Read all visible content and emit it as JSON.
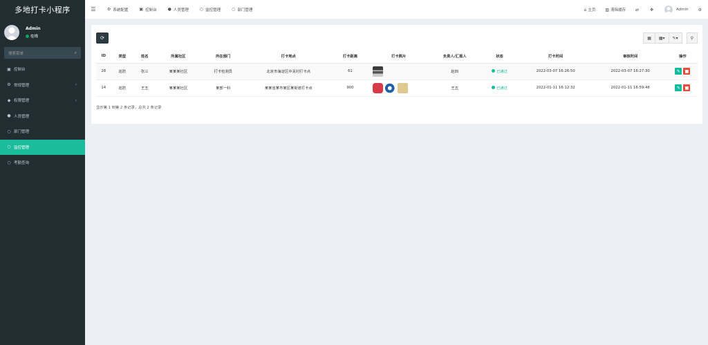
{
  "app": {
    "title": "多地打卡小程序"
  },
  "user": {
    "name": "Admin",
    "status": "在线"
  },
  "sidebar": {
    "search_placeholder": "搜索菜单",
    "items": [
      {
        "label": "控制台",
        "icon": "dashboard-icon",
        "active": false,
        "chevron": false
      },
      {
        "label": "常规管理",
        "icon": "cogs-icon",
        "active": false,
        "chevron": true
      },
      {
        "label": "权限管理",
        "icon": "group-icon",
        "active": false,
        "chevron": true
      },
      {
        "label": "人员管理",
        "icon": "user-icon",
        "active": false,
        "chevron": false
      },
      {
        "label": "部门管理",
        "icon": "circle-icon",
        "active": false,
        "chevron": false
      },
      {
        "label": "监控管理",
        "icon": "circle-icon",
        "active": true,
        "chevron": false
      },
      {
        "label": "考勤查询",
        "icon": "circle-icon",
        "active": false,
        "chevron": false
      }
    ]
  },
  "topbar": {
    "tabs": [
      {
        "label": "系统配置",
        "icon": "gear-icon"
      },
      {
        "label": "控制台",
        "icon": "dashboard-icon"
      },
      {
        "label": "人员管理",
        "icon": "user-icon"
      },
      {
        "label": "监控管理",
        "icon": "circle-icon"
      },
      {
        "label": "部门管理",
        "icon": "circle-icon"
      }
    ],
    "right": {
      "home_label": "主页",
      "clear_cache_label": "清除缓存",
      "admin_label": "Admin"
    }
  },
  "table": {
    "columns": [
      "ID",
      "类型",
      "姓名",
      "所属社区",
      "所在部门",
      "打卡地点",
      "打卡距离",
      "打卡照片",
      "负责人/汇报人",
      "状态",
      "打卡时间",
      "审核时间",
      "操作"
    ],
    "rows": [
      {
        "id": "28",
        "type": "巡防",
        "name": "张三",
        "community": "某某某社区",
        "dept": "打卡检测员",
        "location": "北京市海淀区中关村打卡点",
        "distance": "61",
        "manager": "赵四",
        "status": "已通过",
        "status_color": "#18bc9c",
        "time": "2022-03-07 16:26:50",
        "audit_time": "2022-03-07 16:27:30",
        "photos": [
          "photo-road-icon"
        ]
      },
      {
        "id": "14",
        "type": "巡防",
        "name": "王五",
        "community": "某某某社区",
        "dept": "某部一科",
        "location": "某某省某市某区某街道打卡点",
        "distance": "900",
        "manager": "王五",
        "status": "已通过",
        "status_color": "#18bc9c",
        "time": "2022-01-11 16:12:32",
        "audit_time": "2022-01-11 16:59:48",
        "photos": [
          "photo-red-icon",
          "photo-blue-icon",
          "photo-beige-icon"
        ]
      }
    ]
  },
  "pager": {
    "info": "显示第 1 到第 2 条记录，总共 2 条记录"
  },
  "colors": {
    "sidebar": "#222d32",
    "accent": "#1abc9c",
    "danger": "#e74c3c",
    "dark_button": "#2c3b41"
  }
}
